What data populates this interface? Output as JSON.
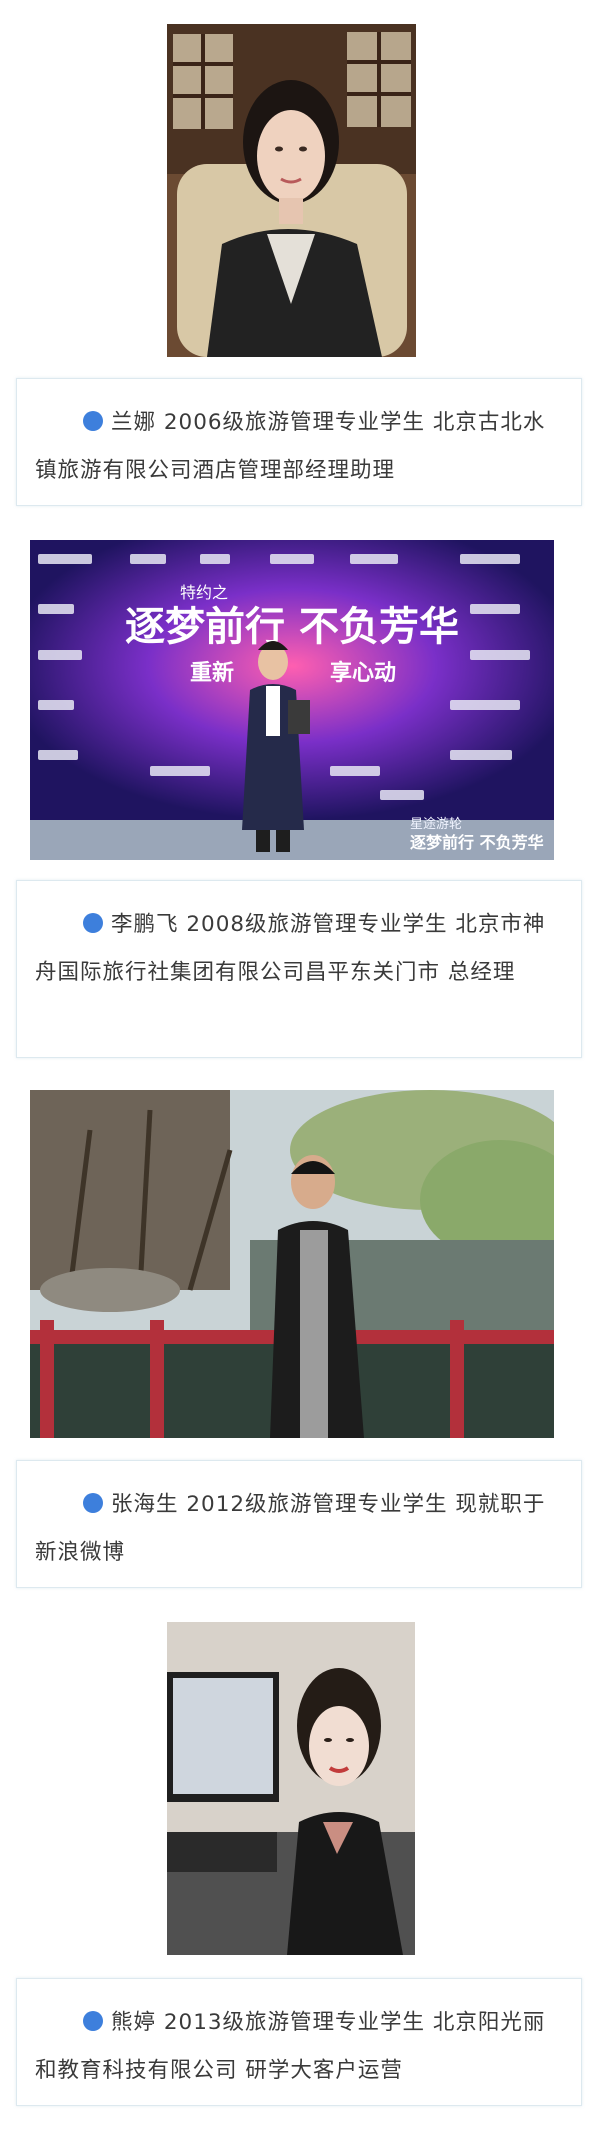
{
  "colors": {
    "bullet": "#3d7fdc",
    "caption_border": "#dde9ef",
    "text": "#3a3a3a"
  },
  "profiles": [
    {
      "text": "兰娜 2006级旅游管理专业学生 北京古北水镇旅游有限公司酒店管理部经理助理"
    },
    {
      "text": "李鹏飞 2008级旅游管理专业学生  北京市神舟国际旅行社集团有限公司昌平东关门市 总经理"
    },
    {
      "text": "张海生 2012级旅游管理专业学生 现就职于新浪微博"
    },
    {
      "text": "熊婷 2013级旅游管理专业学生 北京阳光丽和教育科技有限公司 研学大客户运营"
    }
  ],
  "banner": {
    "headline": "逐梦前行 不负芳华",
    "subline": "重新",
    "subline2": "享心动",
    "kicker": "特约之",
    "footer_small": "星途游轮",
    "footer_big": "逐梦前行 不负芳华"
  }
}
